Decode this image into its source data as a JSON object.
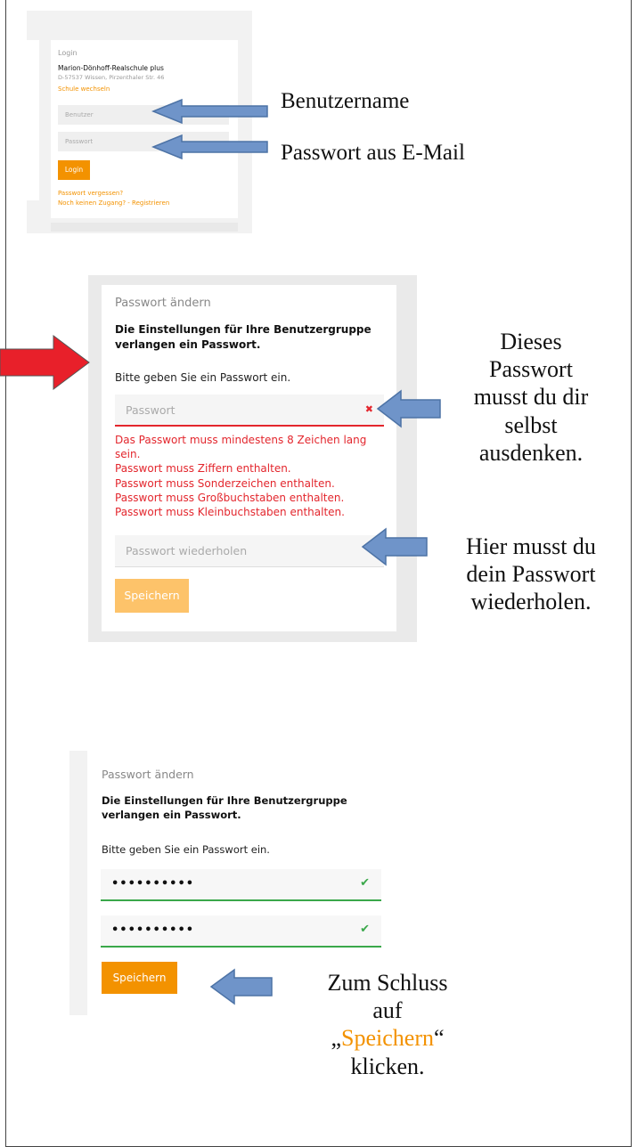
{
  "panel1": {
    "heading": "Login",
    "school_name": "Marion-Dönhoff-Realschule plus",
    "school_address": "D-57537 Wissen, Pirzenthaler Str. 46",
    "change_school_link": "Schule wechseln",
    "username_placeholder": "Benutzer",
    "password_placeholder": "Passwort",
    "login_button": "Login",
    "forgot_password_link": "Passwort vergessen?",
    "register_link": "Noch keinen Zugang? - Registrieren"
  },
  "panel2": {
    "title": "Passwort ändern",
    "info_bold": "Die Einstellungen für Ihre Benutzergruppe verlangen ein Passwort.",
    "prompt": "Bitte geben Sie ein Passwort ein.",
    "password_placeholder": "Passwort",
    "error_icon": "✖",
    "errors": [
      "Das Passwort muss mindestens 8 Zeichen lang sein.",
      "Passwort muss Ziffern enthalten.",
      "Passwort muss Sonderzeichen enthalten.",
      "Passwort muss Großbuchstaben enthalten.",
      "Passwort muss Kleinbuchstaben enthalten."
    ],
    "repeat_placeholder": "Passwort wiederholen",
    "save_button": "Speichern"
  },
  "panel3": {
    "title": "Passwort ändern",
    "info_bold": "Die Einstellungen für Ihre Benutzergruppe verlangen ein Passwort.",
    "prompt": "Bitte geben Sie ein Passwort ein.",
    "password_value": "••••••••••",
    "repeat_value": "••••••••••",
    "check_icon": "✔",
    "save_button": "Speichern"
  },
  "annotations": {
    "username": "Benutzername",
    "password_email": "Passwort aus E-Mail",
    "own_password": [
      "Dieses",
      "Passwort",
      "musst du dir",
      "selbst",
      "ausdenken."
    ],
    "repeat": [
      "Hier musst du",
      "dein Passwort",
      "wiederholen."
    ],
    "final_1": "Zum Schluss",
    "final_2": "auf",
    "final_quote_open": "„",
    "final_word": "Speichern",
    "final_quote_close": "“",
    "final_4": "klicken."
  },
  "colors": {
    "accent_orange": "#f39200",
    "error_red": "#e3262d",
    "success_green": "#3aa84a",
    "arrow_blue": "#6f94c9",
    "arrow_red": "#e8202a"
  },
  "icons": [
    "arrow-left-icon",
    "arrow-right-red-icon",
    "error-x-icon",
    "check-icon"
  ]
}
